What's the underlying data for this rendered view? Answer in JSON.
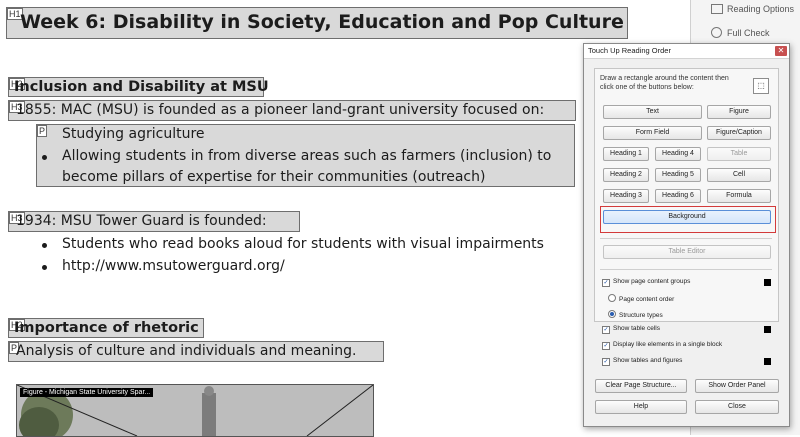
{
  "document": {
    "title": {
      "tag": "H1",
      "text": "Week 6: Disability in Society, Education and Pop Culture"
    },
    "section1": {
      "heading": {
        "tag": "H2",
        "text": "Inclusion and Disability at MSU"
      },
      "item1855": {
        "tag": "H3",
        "text": "1855: MAC (MSU) is founded as a pioneer land-grant university focused on:"
      },
      "list": {
        "tag": "P",
        "items": [
          "Studying agriculture",
          "Allowing students in from diverse areas such as farmers (inclusion) to",
          "become pillars of expertise for their communities (outreach)"
        ]
      },
      "item1934": {
        "tag": "H3",
        "text": "1934: MSU Tower Guard is founded:"
      },
      "list2": [
        "Students who read books aloud for students with visual impairments",
        "http://www.msutowerguard.org/"
      ]
    },
    "section2": {
      "heading": {
        "tag": "H2",
        "text": "Importance of rhetoric"
      },
      "para": {
        "tag": "P",
        "text": "Analysis of culture and individuals and meaning."
      }
    },
    "figure": {
      "tag": "Fig",
      "label": "Figure - Michigan State University Spar..."
    }
  },
  "sidepanel": {
    "items": [
      "Reading Options",
      "Full Check"
    ]
  },
  "dialog": {
    "title": "Touch Up Reading Order",
    "close_glyph": "✕",
    "instructions": "Draw a rectangle around the content then click one of the buttons below:",
    "buttons": {
      "text": "Text",
      "figure": "Figure",
      "form_field": "Form Field",
      "figure_caption": "Figure/Caption",
      "heading1": "Heading 1",
      "heading4": "Heading 4",
      "table": "Table",
      "heading2": "Heading 2",
      "heading5": "Heading 5",
      "cell": "Cell",
      "heading3": "Heading 3",
      "heading6": "Heading 6",
      "formula": "Formula",
      "background": "Background",
      "table_editor": "Table Editor",
      "clear_page_structure": "Clear Page Structure...",
      "show_order_panel": "Show Order Panel",
      "help": "Help",
      "close": "Close"
    },
    "options": {
      "show_page_content_groups": "Show page content groups",
      "page_content_order": "Page content order",
      "structure_types": "Structure types",
      "show_table_cells": "Show table cells",
      "display_like_elements": "Display like elements in a single block",
      "show_tables_and_figures": "Show tables and figures"
    },
    "option_states": {
      "show_page_content_groups": true,
      "page_content_order": false,
      "structure_types": true,
      "show_table_cells": true,
      "display_like_elements": true,
      "show_tables_and_figures": true
    }
  }
}
